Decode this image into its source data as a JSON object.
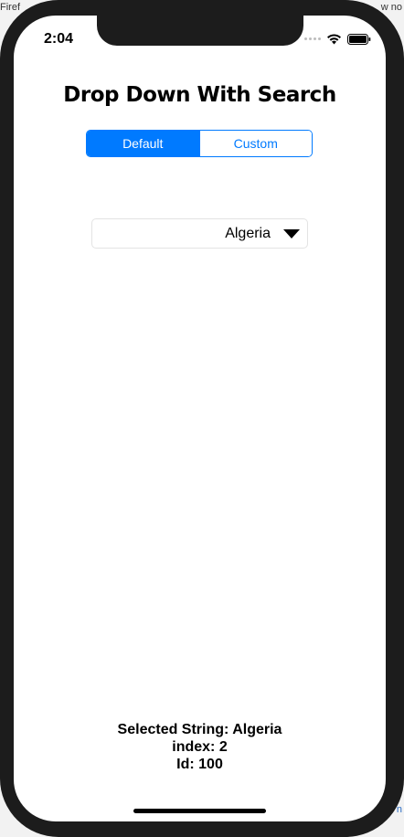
{
  "background": {
    "left_text": "Firef",
    "right_text": "w no",
    "bottom_right_text": "n"
  },
  "status_bar": {
    "time": "2:04"
  },
  "app": {
    "title": "Drop Down With Search",
    "segments": [
      {
        "label": "Default",
        "selected": true
      },
      {
        "label": "Custom",
        "selected": false
      }
    ],
    "dropdown": {
      "selected_value": "Algeria"
    },
    "info": {
      "selected_string": "Selected String: Algeria",
      "index": "index: 2",
      "id": "Id: 100"
    }
  },
  "colors": {
    "accent": "#007aff",
    "frame": "#1c1c1c"
  },
  "icons": {
    "wifi": "wifi-icon",
    "battery": "battery-icon",
    "signal": "signal-icon",
    "dropdown_arrow": "triangle-down-icon"
  }
}
